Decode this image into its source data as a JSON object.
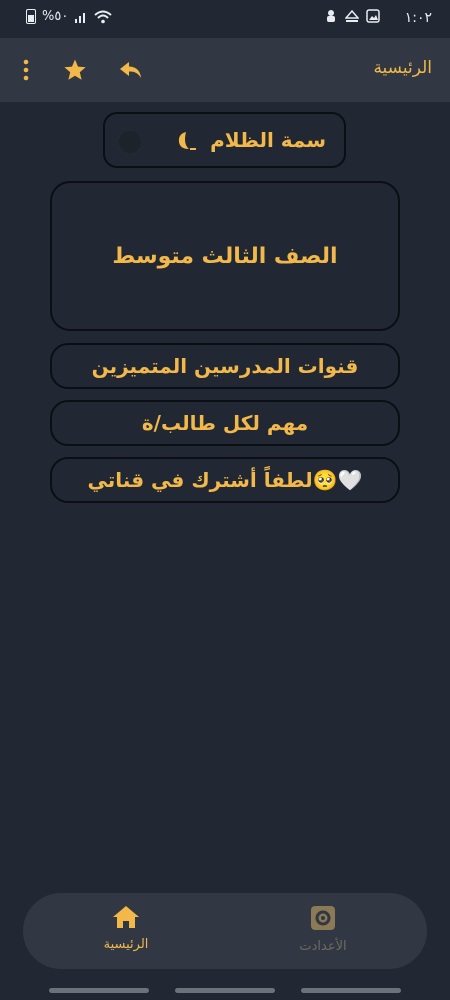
{
  "status_bar": {
    "time": "١:٠٢",
    "battery_text": "%٥٠"
  },
  "appbar": {
    "title": "الرئيسية",
    "icons": [
      "menu-dots-icon",
      "star-icon",
      "share-arrow-icon"
    ]
  },
  "theme_toggle": {
    "label": "سمة الظلام",
    "icon": "moon-icon",
    "enabled": false
  },
  "cards": {
    "grade": "الصف الثالث متوسط",
    "teachers": "قنوات المدرسين المتميزين",
    "important": "مهم لكل طالب/ة",
    "subscribe": "لطفاً أشترك في قناتي🥺🤍"
  },
  "bottom_nav": {
    "home_label": "الرئيسية",
    "settings_label": "الأعدادت"
  },
  "colors": {
    "background": "#222833",
    "accent": "#f2b84a",
    "surface": "#323843",
    "inactive": "#6f6a5f"
  }
}
